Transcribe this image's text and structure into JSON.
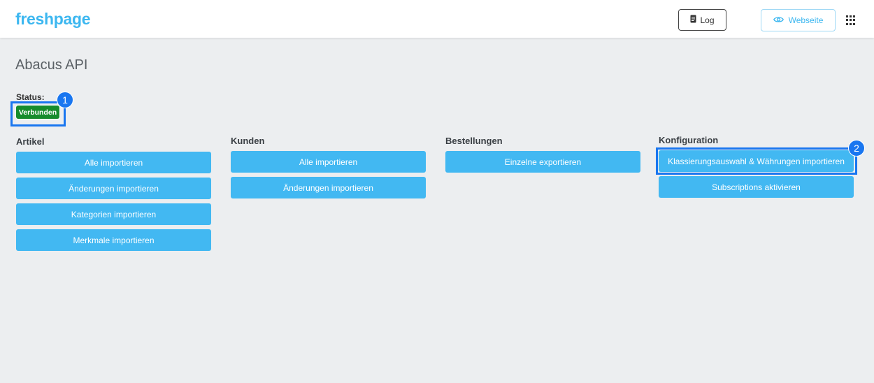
{
  "header": {
    "logo": "freshpage",
    "log_label": "Log",
    "website_label": "Webseite"
  },
  "page": {
    "title": "Abacus API"
  },
  "status": {
    "label": "Status:",
    "value": "Verbunden",
    "color": "#168c2c"
  },
  "markers": [
    "1",
    "2"
  ],
  "columns": {
    "artikel": {
      "heading": "Artikel",
      "buttons": [
        "Alle importieren",
        "Änderungen importieren",
        "Kategorien importieren",
        "Merkmale importieren"
      ]
    },
    "kunden": {
      "heading": "Kunden",
      "buttons": [
        "Alle importieren",
        "Änderungen importieren"
      ]
    },
    "bestellungen": {
      "heading": "Bestellungen",
      "buttons": [
        "Einzelne exportieren"
      ]
    },
    "konfiguration": {
      "heading": "Konfiguration",
      "buttons": [
        "Klassierungsauswahl & Währungen importieren",
        "Subscriptions aktivieren"
      ]
    }
  },
  "colors": {
    "accent": "#3cb7f0",
    "button": "#42b8f2",
    "highlight": "#1976f0"
  },
  "icons": {
    "log": "document-icon",
    "website": "eye-icon",
    "apps": "grid-icon"
  }
}
